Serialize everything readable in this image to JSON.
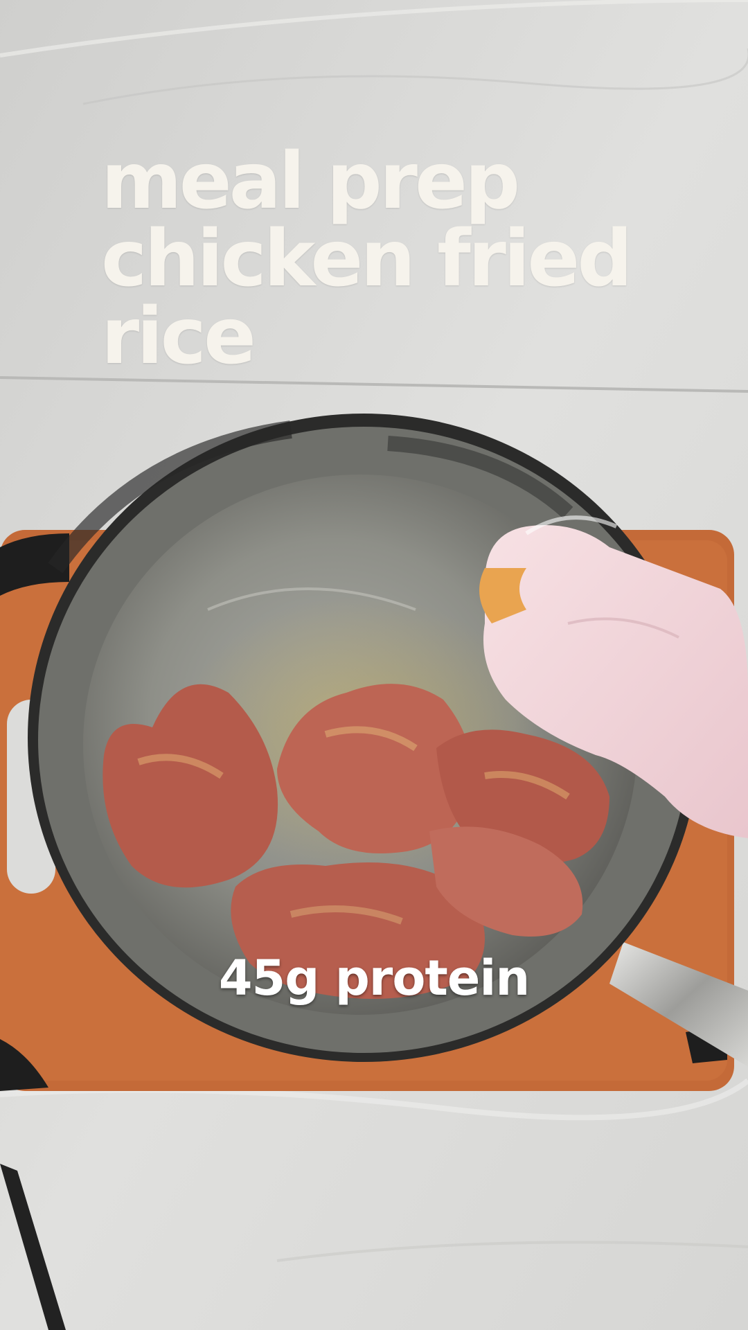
{
  "overlay": {
    "title_lines": [
      "meal prep",
      "chicken fried",
      "rice"
    ],
    "caption": "45g protein"
  },
  "scene": {
    "description_icons": [
      "countertop",
      "cutting-board",
      "skillet",
      "chicken-thighs",
      "gloved-hand",
      "tongs"
    ],
    "colors": {
      "countertop": "#dcdcda",
      "cutting_board": "#c46a38",
      "pan_steel": "#8f8f8c",
      "chicken": "#b55a4a",
      "glove": "#f2d6dc",
      "text": "#f6f3ec"
    }
  }
}
